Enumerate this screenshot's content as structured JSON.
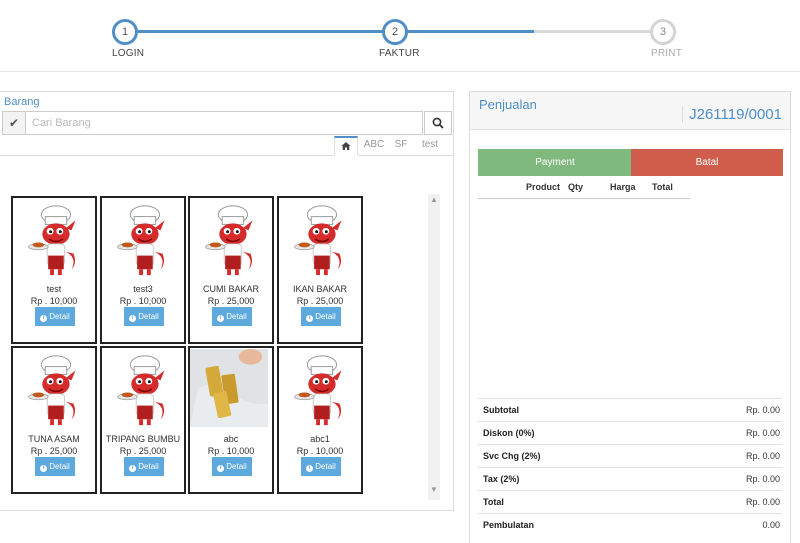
{
  "stepper": {
    "steps": [
      {
        "number": "1",
        "label": "LOGIN"
      },
      {
        "number": "2",
        "label": "FAKTUR"
      },
      {
        "number": "3",
        "label": "PRINT"
      }
    ],
    "active_color": "#4f8fc6",
    "inactive_color": "#d4d4d4"
  },
  "catalog": {
    "title": "Barang",
    "search": {
      "placeholder": "Cari Barang",
      "value": ""
    },
    "tabs": [
      {
        "label": "",
        "icon": "home-icon"
      },
      {
        "label": "ABC"
      },
      {
        "label": "SF"
      },
      {
        "label": "test"
      }
    ],
    "detail_label": "Detail",
    "items": [
      {
        "name": "test",
        "price": "Rp . 10,000",
        "image": "chef-mascot"
      },
      {
        "name": "test3",
        "price": "Rp . 10,000",
        "image": "chef-mascot"
      },
      {
        "name": "CUMI BAKAR",
        "price": "Rp . 25,000",
        "image": "chef-mascot"
      },
      {
        "name": "IKAN BAKAR",
        "price": "Rp . 25,000",
        "image": "chef-mascot"
      },
      {
        "name": "TUNA ASAM",
        "price": "Rp . 25,000",
        "image": "chef-mascot"
      },
      {
        "name": "TRIPANG BUMBU",
        "price": "Rp . 25,000",
        "image": "chef-mascot"
      },
      {
        "name": "abc",
        "price": "Rp . 10,000",
        "image": "gold-bars-photo"
      },
      {
        "name": "abc1",
        "price": "Rp . 10,000",
        "image": "chef-mascot"
      }
    ]
  },
  "sale": {
    "title": "Penjualan",
    "invoice": "J261119/0001",
    "payment_label": "Payment",
    "cancel_label": "Batal",
    "payment_color": "#80b97e",
    "cancel_color": "#d05c4c",
    "columns": [
      "Product",
      "Qty",
      "Harga",
      "Total"
    ],
    "totals": [
      {
        "label": "Subtotal",
        "value": "Rp. 0.00"
      },
      {
        "label": "Diskon (0%)",
        "value": "Rp. 0.00"
      },
      {
        "label": "Svc Chg (2%)",
        "value": "Rp. 0.00"
      },
      {
        "label": "Tax (2%)",
        "value": "Rp. 0.00"
      },
      {
        "label": "Total",
        "value": "Rp. 0.00"
      },
      {
        "label": "Pembulatan",
        "value": "0.00"
      }
    ]
  }
}
